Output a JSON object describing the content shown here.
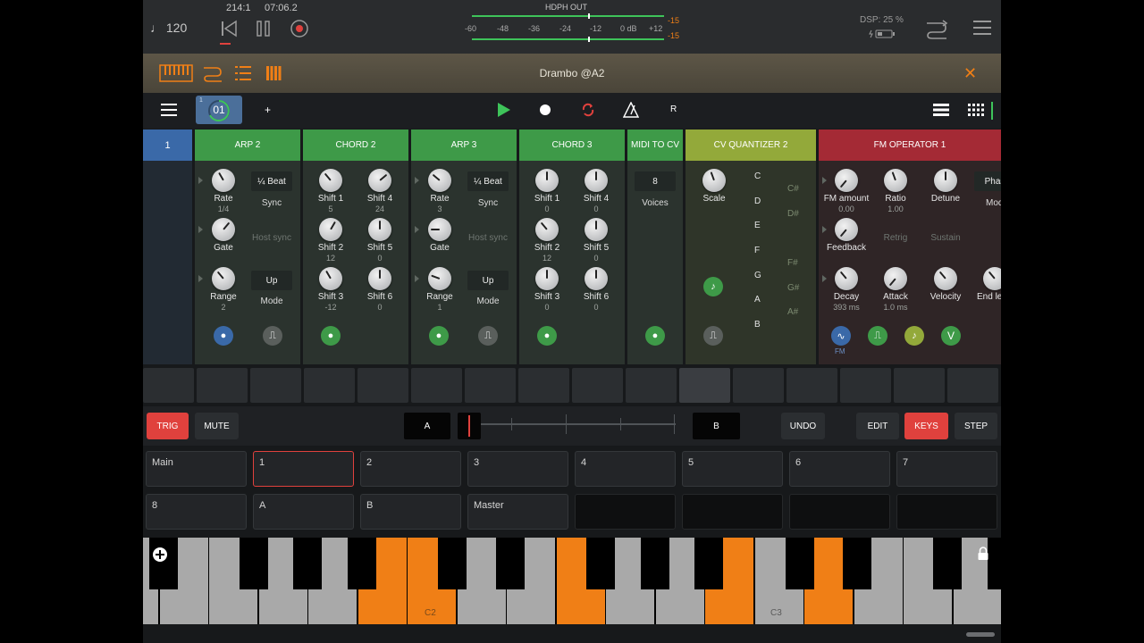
{
  "topbar": {
    "tempo": "♩ 120",
    "position": "214:1",
    "time": "07:06.2",
    "output_label": "HDPH OUT",
    "meter_ticks": [
      "-60",
      "-48",
      "-36",
      "-24",
      "-12",
      "0 dB",
      "+12"
    ],
    "meter_peak_top": "-15",
    "meter_peak_bottom": "-15",
    "dsp": "DSP: 25 %",
    "battery_icon": "battery-icon",
    "colors": {
      "accent": "#f07f16",
      "record": "#e0413d",
      "meter": "#3ec45a"
    }
  },
  "plugin": {
    "title": "Drambo @A2",
    "close": "✕"
  },
  "transport": {
    "pattern": "01",
    "pattern_small": "1",
    "add": "+",
    "r_label": "R"
  },
  "track": {
    "number": "1"
  },
  "modules": {
    "arp2": {
      "title": "ARP 2",
      "rate_label": "Rate",
      "rate_value": "1/4",
      "sync_box": "¼ Beat",
      "sync_label": "Sync",
      "gate_label": "Gate",
      "host_sync": "Host sync",
      "range_label": "Range",
      "range_value": "2",
      "mode_box": "Up",
      "mode_label": "Mode"
    },
    "chord2": {
      "title": "CHORD 2",
      "s1": "Shift 1",
      "v1": "5",
      "s4": "Shift 4",
      "v4": "24",
      "s2": "Shift 2",
      "v2": "12",
      "s5": "Shift 5",
      "v5": "0",
      "s3": "Shift 3",
      "v3": "-12",
      "s6": "Shift 6",
      "v6": "0"
    },
    "arp3": {
      "title": "ARP 3",
      "rate_label": "Rate",
      "rate_value": "3",
      "sync_box": "¼ Beat",
      "sync_label": "Sync",
      "gate_label": "Gate",
      "host_sync": "Host sync",
      "range_label": "Range",
      "range_value": "1",
      "mode_box": "Up",
      "mode_label": "Mode"
    },
    "chord3": {
      "title": "CHORD 3",
      "s1": "Shift 1",
      "v1": "0",
      "s4": "Shift 4",
      "v4": "0",
      "s2": "Shift 2",
      "v2": "12",
      "s5": "Shift 5",
      "v5": "0",
      "s3": "Shift 3",
      "v3": "0",
      "s6": "Shift 6",
      "v6": "0"
    },
    "midicv": {
      "title": "MIDI TO CV",
      "voices_box": "8",
      "voices_label": "Voices"
    },
    "cvq": {
      "title": "CV QUANTIZER 2",
      "scale_label": "Scale",
      "notes": [
        "C",
        "D",
        "E",
        "F",
        "G",
        "A",
        "B"
      ],
      "sharps": [
        "C#",
        "D#",
        "F#",
        "G#",
        "A#"
      ]
    },
    "fm": {
      "title": "FM OPERATOR 1",
      "fm_amount": "FM amount",
      "fm_amount_v": "0.00",
      "ratio": "Ratio",
      "ratio_v": "1.00",
      "detune": "Detune",
      "phase": "Phas",
      "mode": "Mod",
      "feedback": "Feedback",
      "retrig": "Retrig",
      "sustain": "Sustain",
      "decay": "Decay",
      "decay_v": "393 ms",
      "attack": "Attack",
      "attack_v": "1.0 ms",
      "velocity": "Velocity",
      "endlevel": "End le",
      "fm_port": "FM",
      "v_port": "V"
    }
  },
  "bottom": {
    "trig": "TRIG",
    "mute": "MUTE",
    "a": "A",
    "b": "B",
    "undo": "UNDO",
    "edit": "EDIT",
    "keys": "KEYS",
    "step": "STEP"
  },
  "slots_row1": [
    "Main",
    "1",
    "2",
    "3",
    "4",
    "5",
    "6",
    "7"
  ],
  "slots_row2": [
    "8",
    "A",
    "B",
    "Master"
  ],
  "keyboard": {
    "c2": "C2",
    "c3": "C3"
  }
}
